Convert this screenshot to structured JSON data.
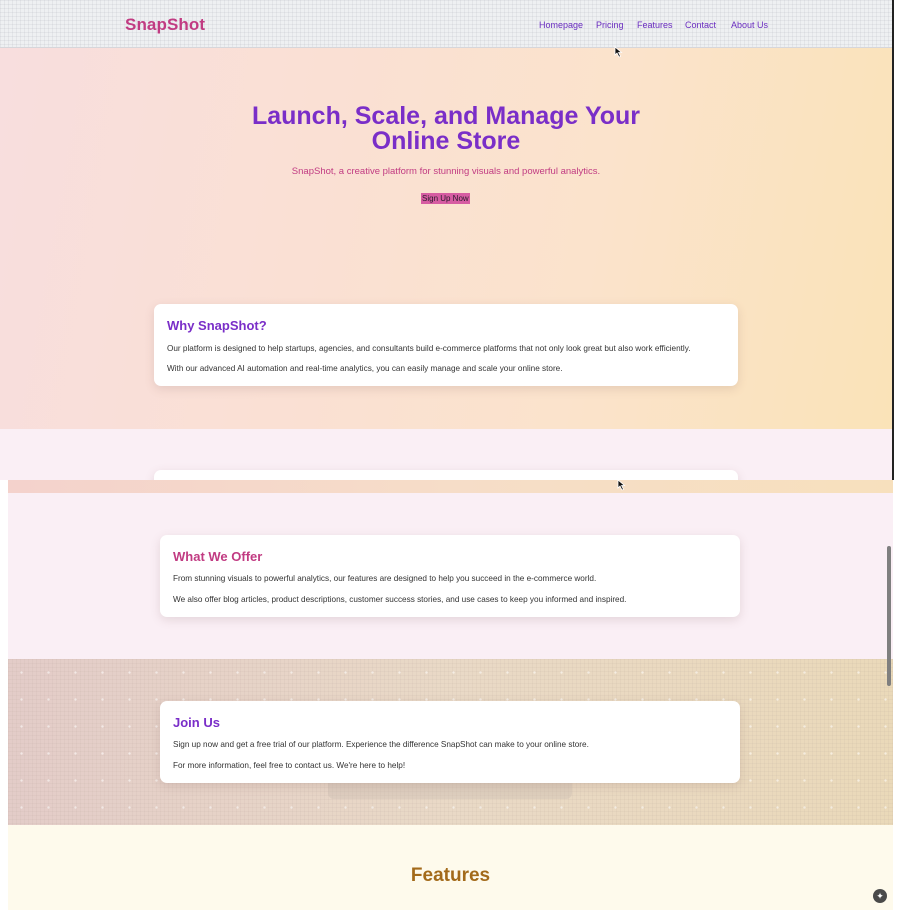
{
  "brand": {
    "name": "SnapShot"
  },
  "nav": {
    "items": [
      "Homepage",
      "Pricing",
      "Features",
      "Contact",
      "About Us"
    ]
  },
  "hero": {
    "title_line1": "Launch, Scale, and Manage Your",
    "title_line2": "Online Store",
    "subtitle": "SnapShot, a creative platform for stunning visuals and powerful analytics.",
    "cta_label": "Sign Up Now"
  },
  "why": {
    "heading": "Why SnapShot?",
    "paragraph1": "Our platform is designed to help startups, agencies, and consultants build e-commerce platforms that not only look great but also work efficiently.",
    "paragraph2": "With our advanced AI automation and real-time analytics, you can easily manage and scale your online store."
  },
  "offer": {
    "heading": "What We Offer",
    "paragraph1": "From stunning visuals to powerful analytics, our features are designed to help you succeed in the e-commerce world.",
    "paragraph2": "We also offer blog articles, product descriptions, customer success stories, and use cases to keep you informed and inspired."
  },
  "join": {
    "heading": "Join Us",
    "paragraph1": "Sign up now and get a free trial of our platform. Experience the difference SnapShot can make to your online store.",
    "paragraph2": "For more information, feel free to contact us. We're here to help!"
  },
  "features": {
    "heading": "Features"
  },
  "colors": {
    "brand_pink": "#c13b82",
    "brand_purple": "#7a2ec8",
    "features_brown": "#a36a1a",
    "cta_background": "#d65ca2"
  },
  "icons": {
    "cursor": "arrow-cursor-icon",
    "corner": "assistant-icon"
  }
}
